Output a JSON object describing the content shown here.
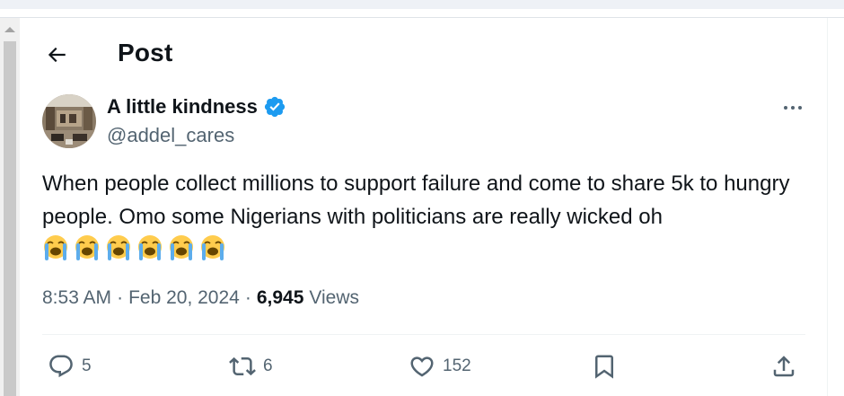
{
  "header": {
    "title": "Post"
  },
  "author": {
    "name": "A little kindness",
    "handle": "@addel_cares",
    "verified": true
  },
  "tweet": {
    "text": "When people collect millions to support failure and come to share 5k to hungry people.  Omo some Nigerians with politicians are really wicked oh",
    "emoji": [
      "loudly-crying-face",
      "loudly-crying-face",
      "loudly-crying-face",
      "loudly-crying-face",
      "loudly-crying-face",
      "loudly-crying-face"
    ]
  },
  "meta": {
    "time": "8:53 AM",
    "date": "Feb 20, 2024",
    "views_count": "6,945",
    "views_label": "Views",
    "separator": "·"
  },
  "actions": {
    "replies": "5",
    "reposts": "6",
    "likes": "152"
  },
  "colors": {
    "verified": "#1d9bf0",
    "text": "#0f1419",
    "secondary": "#536471"
  }
}
